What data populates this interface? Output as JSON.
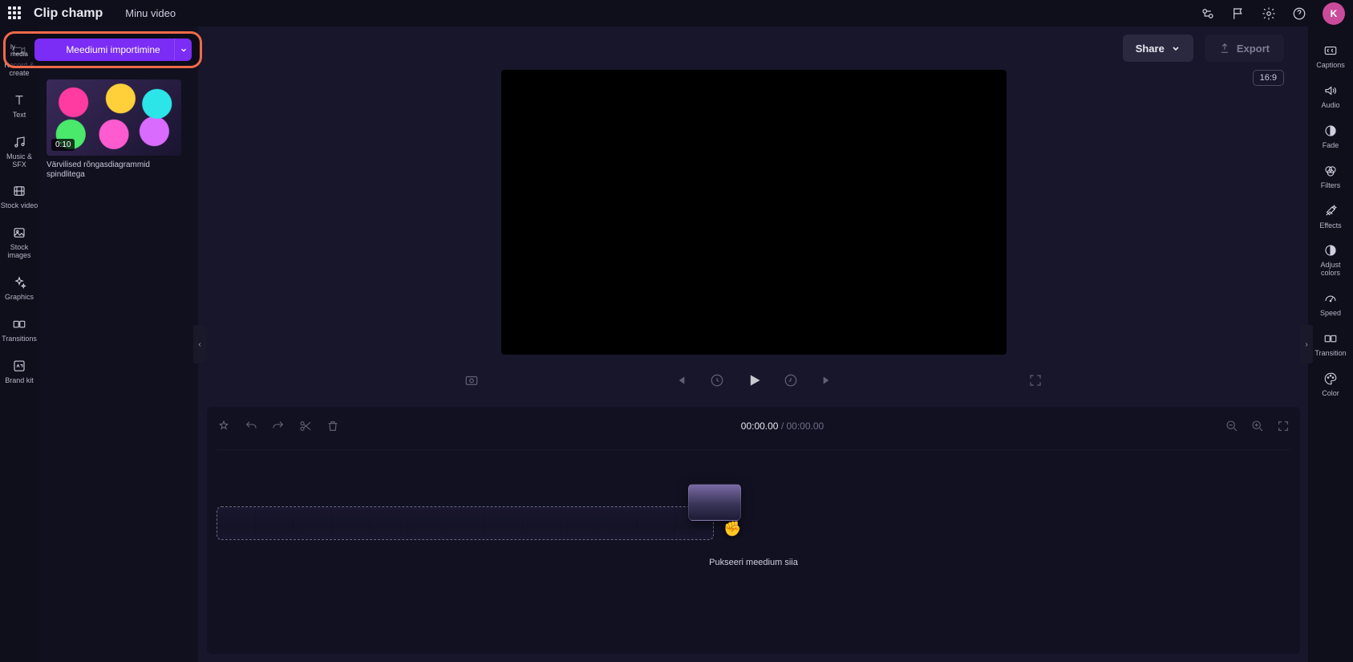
{
  "app": {
    "name": "Clip champ",
    "project_title": "Minu video"
  },
  "avatar": {
    "initial": "K"
  },
  "import": {
    "button_label": "Meediumi importimine",
    "folder_label": "ly media"
  },
  "media_item": {
    "duration": "0:10",
    "name": "Värvilised rõngasdiagrammid spindlitega"
  },
  "left_rail": [
    {
      "label": "ly media",
      "icon": "folder"
    },
    {
      "label": "Record & create",
      "icon": "camera"
    },
    {
      "label": "Text",
      "icon": "text"
    },
    {
      "label": "Music & SFX",
      "icon": "music"
    },
    {
      "label": "Stock video",
      "icon": "film"
    },
    {
      "label": "Stock images",
      "icon": "image"
    },
    {
      "label": "Graphics",
      "icon": "sparkle"
    },
    {
      "label": "Transitions",
      "icon": "transition"
    },
    {
      "label": "Brand kit",
      "icon": "brand"
    }
  ],
  "right_rail": [
    {
      "label": "Captions",
      "icon": "cc"
    },
    {
      "label": "Audio",
      "icon": "speaker"
    },
    {
      "label": "Fade",
      "icon": "fade"
    },
    {
      "label": "Filters",
      "icon": "filters"
    },
    {
      "label": "Effects",
      "icon": "fx"
    },
    {
      "label": "Adjust colors",
      "icon": "contrast"
    },
    {
      "label": "Speed",
      "icon": "gauge"
    },
    {
      "label": "Transition",
      "icon": "transition"
    },
    {
      "label": "Color",
      "icon": "palette"
    }
  ],
  "actions": {
    "share": "Share",
    "export": "Export"
  },
  "aspect_ratio": "16:9",
  "timeline": {
    "current": "00:00.00",
    "total": "00:00.00",
    "hint": "Pukseeri meedium siia"
  }
}
